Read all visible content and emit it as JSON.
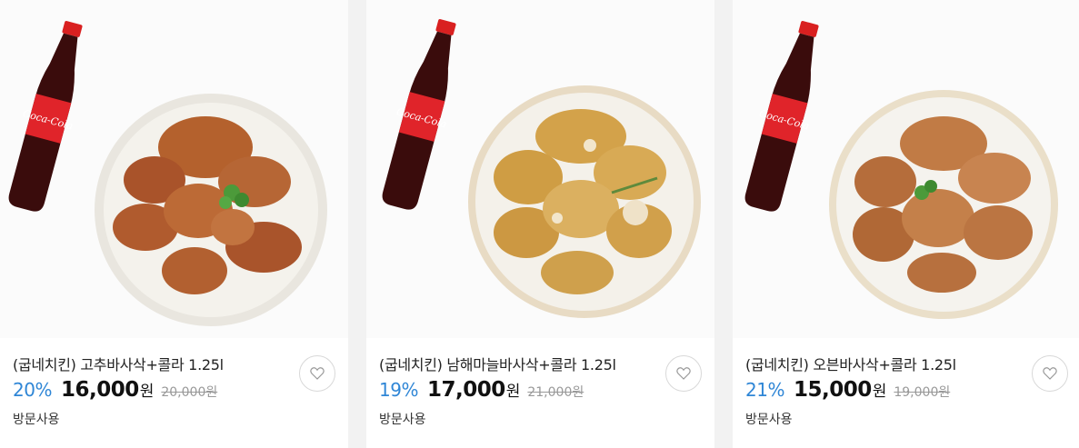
{
  "products": [
    {
      "title": "(굽네치킨) 고추바사삭+콜라 1.25l",
      "discount_rate": "20%",
      "price": "16,000",
      "currency": "원",
      "original_price": "20,000원",
      "tag": "방문사용",
      "bottle_label": "Coca-Cola",
      "chicken_color": "#b4612d"
    },
    {
      "title": "(굽네치킨) 남해마늘바사삭+콜라 1.25l",
      "discount_rate": "19%",
      "price": "17,000",
      "currency": "원",
      "original_price": "21,000원",
      "tag": "방문사용",
      "bottle_label": "Coca-Cola",
      "chicken_color": "#d3a24a"
    },
    {
      "title": "(굽네치킨) 오븐바사삭+콜라 1.25l",
      "discount_rate": "21%",
      "price": "15,000",
      "currency": "원",
      "original_price": "19,000원",
      "tag": "방문사용",
      "bottle_label": "Coca-Cola",
      "chicken_color": "#c17b45"
    }
  ],
  "icons": {
    "wishlist": "heart-icon"
  },
  "colors": {
    "discount": "#2f86d6",
    "strike": "#999999"
  }
}
